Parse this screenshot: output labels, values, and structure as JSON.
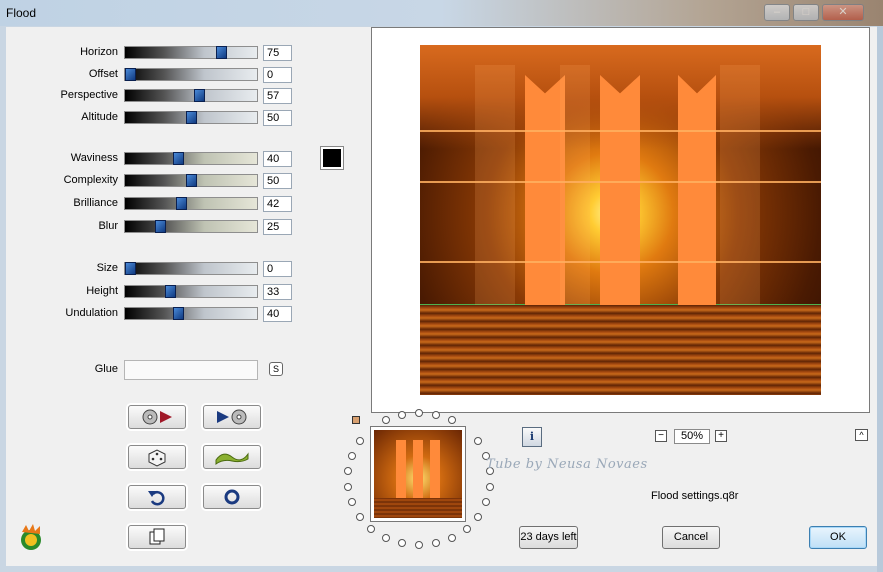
{
  "window": {
    "title": "Flood"
  },
  "params_group1": [
    {
      "label": "Horizon",
      "value": "75",
      "fraction": 0.75
    },
    {
      "label": "Offset",
      "value": "0",
      "fraction": 0.0
    },
    {
      "label": "Perspective",
      "value": "57",
      "fraction": 0.57
    },
    {
      "label": "Altitude",
      "value": "50",
      "fraction": 0.5
    }
  ],
  "params_group2": [
    {
      "label": "Waviness",
      "value": "40",
      "fraction": 0.4
    },
    {
      "label": "Complexity",
      "value": "50",
      "fraction": 0.5
    },
    {
      "label": "Brilliance",
      "value": "42",
      "fraction": 0.42
    },
    {
      "label": "Blur",
      "value": "25",
      "fraction": 0.25
    }
  ],
  "params_group3": [
    {
      "label": "Size",
      "value": "0",
      "fraction": 0.0
    },
    {
      "label": "Height",
      "value": "33",
      "fraction": 0.33
    },
    {
      "label": "Undulation",
      "value": "40",
      "fraction": 0.4
    }
  ],
  "glue": {
    "label": "Glue",
    "s_button": "S",
    "value": ""
  },
  "color_swatch": "#000000",
  "watermark": "Tube by Neusa Novaes",
  "zoom": {
    "minus": "−",
    "value": "50%",
    "plus": "+"
  },
  "info_label": "i",
  "collapse_label": "^",
  "settings_file": "Flood settings.q8r",
  "trial_label": "23 days left",
  "cancel_label": "Cancel",
  "ok_label": "OK",
  "colors": {
    "accent": "#3c7fb1",
    "picket": "#ff8a3a",
    "sunset": "#d86a1e"
  }
}
